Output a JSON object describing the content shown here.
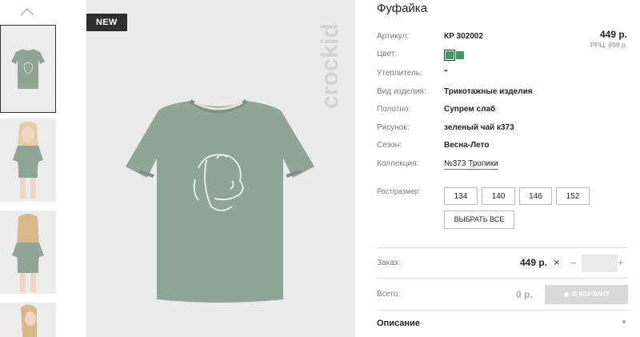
{
  "product": {
    "title": "Фуфайка",
    "badge": "NEW",
    "brand": "crockid",
    "price": "449 р.",
    "rrp": "РРЦ: 899 р."
  },
  "specs": [
    {
      "label": "Артикул:",
      "value": "КР 302002"
    },
    {
      "label": "Цвет:",
      "value": ""
    },
    {
      "label": "Утеплитель:",
      "value": "\""
    },
    {
      "label": "Вид изделия:",
      "value": "Трикотажные изделия"
    },
    {
      "label": "Полотно:",
      "value": "Супрем слаб"
    },
    {
      "label": "Рисунок:",
      "value": "зеленый чай к373"
    },
    {
      "label": "Сезон:",
      "value": "Весна-Лето"
    },
    {
      "label": "Коллекция:",
      "value": "№373 Тропики"
    }
  ],
  "colors": [
    "#3f9a63",
    "#3f9a63"
  ],
  "sizes": {
    "label": "Рост/размер:",
    "options": [
      "134",
      "140",
      "146",
      "152"
    ],
    "select_all": "ВЫБРАТЬ ВСЕ"
  },
  "order": {
    "label": "Заказ:",
    "price": "449 р.",
    "times": "×",
    "minus": "–",
    "plus": "+",
    "quantity": ""
  },
  "total": {
    "label": "Всего:",
    "value": "0 р.",
    "cart_button": "В КОРЗИНУ"
  },
  "description": {
    "label": "Описание",
    "caret": "▼"
  },
  "icons": {
    "up": "chevron-up-icon",
    "cart": "cart-icon"
  },
  "colors_theme": {
    "shirt": "#8fa596",
    "bg_image": "#ebebeb",
    "badge": "#2f2f2f",
    "button_disabled": "#d9d9d9"
  }
}
